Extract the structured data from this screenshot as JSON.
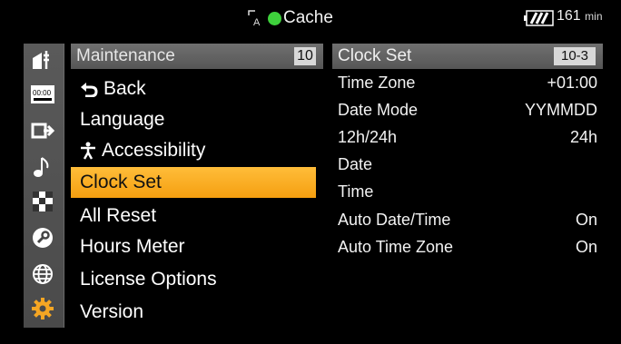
{
  "topbar": {
    "title": "Cache",
    "battery_minutes": "161",
    "battery_unit": "min"
  },
  "sidebar": {
    "icons": [
      "camera-settings-icon",
      "timecode-icon",
      "output-icon",
      "audio-note-icon",
      "checker-pattern-icon",
      "wrench-icon",
      "globe-icon",
      "gear-icon"
    ],
    "active_index": 7
  },
  "menu": {
    "header_label": "Maintenance",
    "header_page": "10",
    "items": [
      {
        "label": "Back",
        "icon": "back-arrow-icon"
      },
      {
        "label": "Language"
      },
      {
        "label": "Accessibility",
        "icon": "accessibility-icon"
      },
      {
        "label": "Clock Set",
        "selected": true
      },
      {
        "label": "All Reset"
      },
      {
        "label": "Hours Meter"
      },
      {
        "label": "License Options"
      },
      {
        "label": "Version"
      }
    ]
  },
  "detail": {
    "title": "Clock Set",
    "page": "10-3",
    "rows": [
      {
        "label": "Time Zone",
        "value": "+01:00"
      },
      {
        "label": "Date Mode",
        "value": "YYMMDD"
      },
      {
        "label": "12h/24h",
        "value": "24h"
      },
      {
        "label": "Date",
        "value": ""
      },
      {
        "label": "Time",
        "value": ""
      },
      {
        "label": "Auto Date/Time",
        "value": "On"
      },
      {
        "label": "Auto Time Zone",
        "value": "On"
      }
    ]
  },
  "colors": {
    "selected_bg": "#f8a91d",
    "rec_indicator": "#3ed13c",
    "active_icon": "#f5a623"
  }
}
